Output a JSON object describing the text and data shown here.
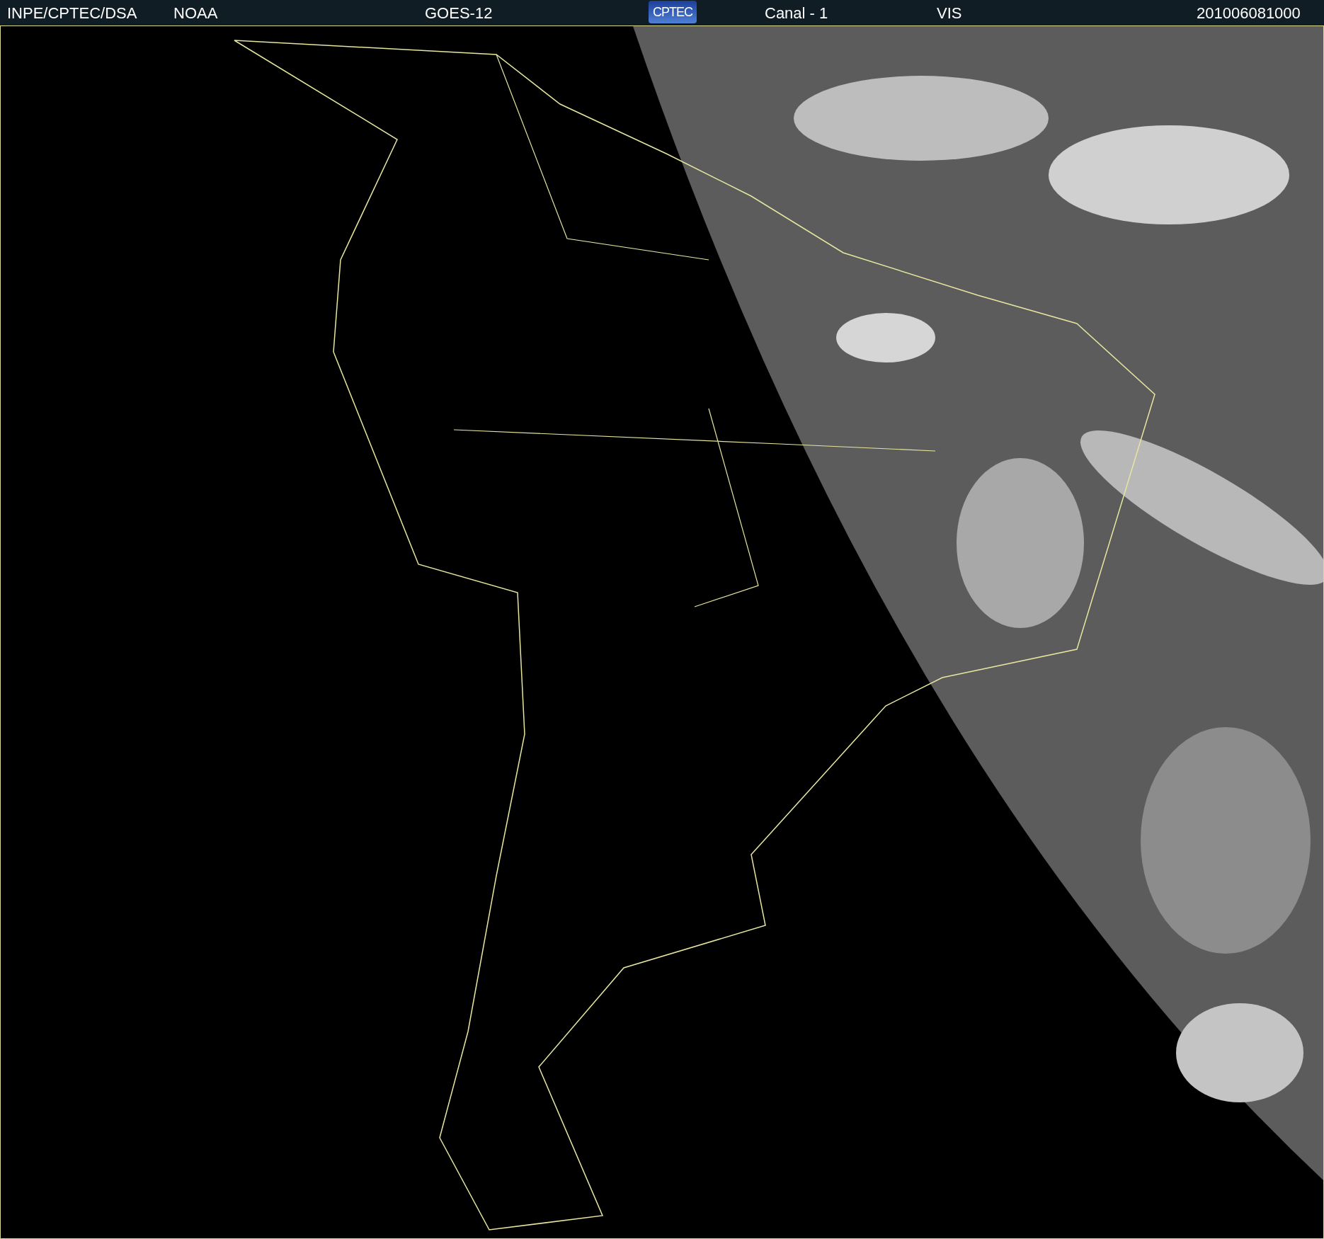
{
  "header": {
    "items": [
      {
        "kind": "text",
        "text": "INPE/CPTEC/DSA"
      },
      {
        "kind": "text",
        "text": "NOAA"
      },
      {
        "kind": "text",
        "text": "GOES-12"
      },
      {
        "kind": "logo",
        "text": "CPTEC"
      },
      {
        "kind": "text",
        "text": "Canal - 1"
      },
      {
        "kind": "text",
        "text": "VIS"
      },
      {
        "kind": "text",
        "text": "201006081000"
      }
    ]
  }
}
